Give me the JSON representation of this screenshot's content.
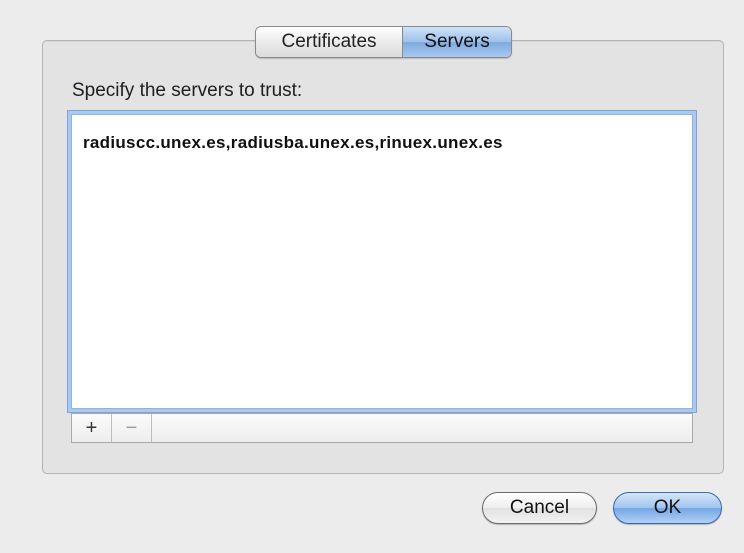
{
  "tabs": {
    "certificates_label": "Certificates",
    "servers_label": "Servers",
    "selected": "Servers"
  },
  "panel": {
    "instruction": "Specify the servers to trust:",
    "servers_list": [
      "radiuscc.unex.es,radiusba.unex.es,rinuex.unex.es"
    ],
    "add_label": "+",
    "remove_label": "−"
  },
  "buttons": {
    "cancel_label": "Cancel",
    "ok_label": "OK"
  },
  "colors": {
    "accent": "#7faae0",
    "background": "#ececec"
  }
}
